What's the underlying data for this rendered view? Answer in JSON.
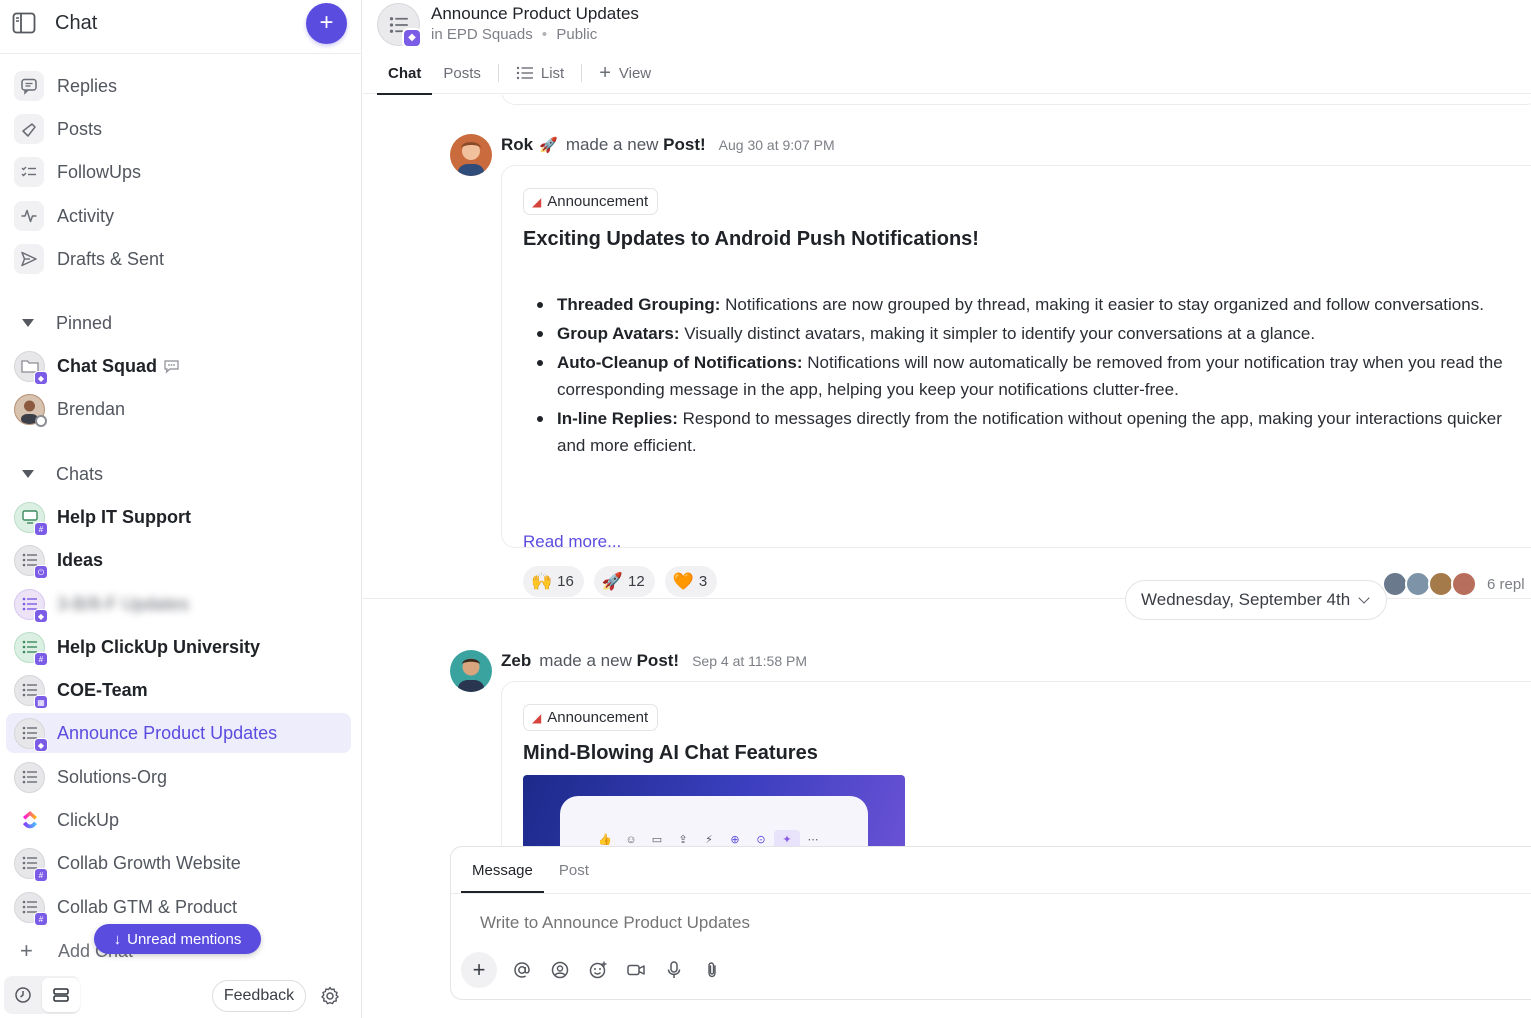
{
  "sidebar": {
    "title": "Chat",
    "nav": [
      {
        "label": "Replies",
        "icon": "replies-icon"
      },
      {
        "label": "Posts",
        "icon": "posts-icon"
      },
      {
        "label": "FollowUps",
        "icon": "followups-icon"
      },
      {
        "label": "Activity",
        "icon": "activity-icon"
      },
      {
        "label": "Drafts & Sent",
        "icon": "send-icon"
      }
    ],
    "pinned_label": "Pinned",
    "pinned": [
      {
        "label": "Chat Squad"
      },
      {
        "label": "Brendan"
      }
    ],
    "chats_label": "Chats",
    "chats": [
      {
        "label": "Help IT Support",
        "unread": true
      },
      {
        "label": "Ideas",
        "unread": true
      },
      {
        "label": "3-B/8-F Updates",
        "unread": false,
        "blurred": true
      },
      {
        "label": "Help ClickUp University",
        "unread": true
      },
      {
        "label": "COE-Team",
        "unread": true
      },
      {
        "label": "Announce Product Updates",
        "active": true
      },
      {
        "label": "Solutions-Org"
      },
      {
        "label": "ClickUp"
      },
      {
        "label": "Collab Growth Website"
      },
      {
        "label": "Collab GTM & Product"
      }
    ],
    "add_chat": "Add Chat",
    "unread_mentions": "Unread mentions",
    "feedback": "Feedback"
  },
  "channel": {
    "title": "Announce Product Updates",
    "space": "in EPD Squads",
    "visibility": "Public",
    "tabs": {
      "chat": "Chat",
      "posts": "Posts",
      "list": "List",
      "view": "View"
    }
  },
  "posts": [
    {
      "author": "Rok",
      "author_emoji": "🚀",
      "action_prefix": "made a new",
      "action_bold": "Post!",
      "time": "Aug 30 at 9:07 PM",
      "tag": "Announcement",
      "title": "Exciting Updates to Android Push Notifications!",
      "bullets": [
        {
          "bold": "Threaded Grouping:",
          "text": " Notifications are now grouped by thread, making it easier to stay organized and follow conversations."
        },
        {
          "bold": "Group Avatars:",
          "text": " Visually distinct avatars, making it simpler to identify your conversations at a glance."
        },
        {
          "bold": "Auto-Cleanup of Notifications:",
          "text": " Notifications will now automatically be removed from your notification tray when you read the corresponding message in the app, helping you keep your notifications clutter-free."
        },
        {
          "bold": "In-line Replies:",
          "text": " Respond to messages directly from the notification without opening the app, making your interactions quicker and more efficient."
        }
      ],
      "read_more": "Read more...",
      "reactions": [
        {
          "emoji": "🙌",
          "count": "16"
        },
        {
          "emoji": "🚀",
          "count": "12"
        },
        {
          "emoji": "🧡",
          "count": "3"
        }
      ],
      "replies_label": "6 repl"
    },
    {
      "author": "Zeb",
      "action_prefix": "made a new",
      "action_bold": "Post!",
      "time": "Sep 4 at 11:58 PM",
      "tag": "Announcement",
      "title": "Mind-Blowing AI Chat Features"
    }
  ],
  "date_divider": "Wednesday, September 4th",
  "composer": {
    "tab_message": "Message",
    "tab_post": "Post",
    "placeholder": "Write to Announce Product Updates"
  },
  "colors": {
    "accent": "#5b4ce0",
    "badge": "#7b5ce6",
    "announcement_icon": "#d6453d"
  }
}
